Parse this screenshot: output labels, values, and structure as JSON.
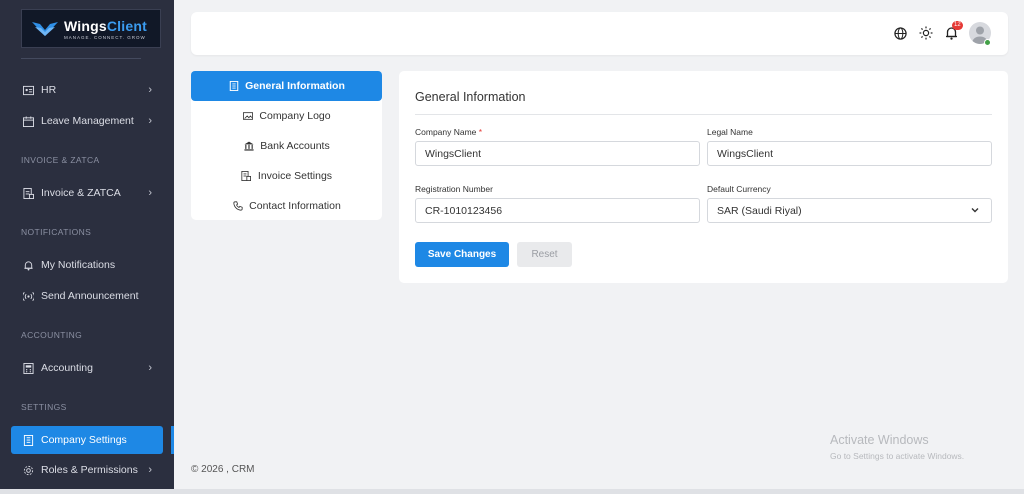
{
  "brand": {
    "name_main": "Wings",
    "name_accent": "Client",
    "tagline": "MANAGE. CONNECT. GROW"
  },
  "sidebar": {
    "items": [
      {
        "label": "HR",
        "icon": "id-card-icon",
        "has_chevron": true
      },
      {
        "label": "Leave Management",
        "icon": "calendar-icon",
        "has_chevron": true
      },
      {
        "label": "Invoice & ZATCA",
        "icon": "invoice-icon",
        "has_chevron": true
      },
      {
        "label": "My Notifications",
        "icon": "bell-icon",
        "has_chevron": false
      },
      {
        "label": "Send Announcement",
        "icon": "broadcast-icon",
        "has_chevron": false
      },
      {
        "label": "Accounting",
        "icon": "calculator-icon",
        "has_chevron": true
      },
      {
        "label": "Company Settings",
        "icon": "building-icon",
        "has_chevron": false,
        "active": true
      },
      {
        "label": "Roles & Permissions",
        "icon": "gear-icon",
        "has_chevron": true
      }
    ],
    "sections": [
      "INVOICE & ZATCA",
      "NOTIFICATIONS",
      "ACCOUNTING",
      "SETTINGS"
    ],
    "chevron": "›"
  },
  "topbar": {
    "notification_count": "12"
  },
  "settings_menu": {
    "items": [
      {
        "label": "General Information",
        "icon": "building-icon",
        "active": true
      },
      {
        "label": "Company Logo",
        "icon": "image-icon"
      },
      {
        "label": "Bank Accounts",
        "icon": "bank-icon"
      },
      {
        "label": "Invoice Settings",
        "icon": "receipt-icon"
      },
      {
        "label": "Contact Information",
        "icon": "phone-icon"
      }
    ]
  },
  "form": {
    "title": "General Information",
    "company_name_label": "Company Name",
    "required_mark": "*",
    "company_name_value": "WingsClient",
    "legal_name_label": "Legal Name",
    "legal_name_value": "WingsClient",
    "registration_label": "Registration Number",
    "registration_value": "CR-1010123456",
    "currency_label": "Default Currency",
    "currency_value": "SAR (Saudi Riyal)",
    "save_label": "Save Changes",
    "reset_label": "Reset"
  },
  "footer": {
    "text": "© 2026 , CRM"
  },
  "watermark": {
    "line1": "Activate Windows",
    "line2": "Go to Settings to activate Windows."
  },
  "colors": {
    "accent": "#1e88e5",
    "sidebar_bg": "#2b2f3f",
    "required": "#e53935",
    "online": "#43a047"
  }
}
